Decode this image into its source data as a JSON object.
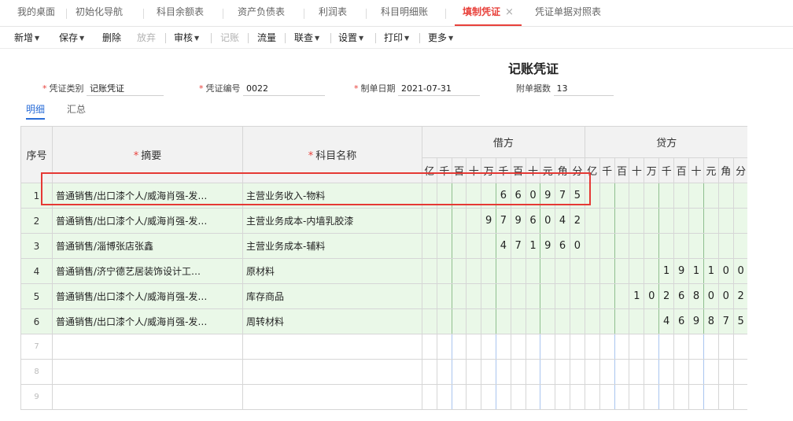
{
  "tabs": [
    {
      "label": "我的桌面"
    },
    {
      "label": "初始化导航"
    },
    {
      "label": "科目余额表"
    },
    {
      "label": "资产负债表"
    },
    {
      "label": "利润表"
    },
    {
      "label": "科目明细账"
    },
    {
      "label": "填制凭证",
      "close": "×"
    },
    {
      "label": "凭证单据对照表"
    }
  ],
  "toolbar": {
    "new": "新增",
    "save": "保存",
    "delete": "删除",
    "discard": "放弃",
    "audit": "审核",
    "post": "记账",
    "cashflow": "流量",
    "link": "联查",
    "settings": "设置",
    "print": "打印",
    "more": "更多"
  },
  "voucher": {
    "title": "记账凭证",
    "type_label": "凭证类别",
    "type_value": "记账凭证",
    "no_label": "凭证编号",
    "no_value": "0022",
    "date_label": "制单日期",
    "date_value": "2021-07-31",
    "attach_label": "附单据数",
    "attach_value": "13"
  },
  "subtabs": {
    "detail": "明细",
    "summary": "汇总"
  },
  "grid": {
    "col_seq": "序号",
    "col_summary": "摘要",
    "col_account": "科目名称",
    "col_debit": "借方",
    "col_credit": "贷方",
    "required_mark": "*",
    "digit_headers": [
      "亿",
      "千",
      "百",
      "十",
      "万",
      "千",
      "百",
      "十",
      "元",
      "角",
      "分"
    ],
    "rows": [
      {
        "seq": "1",
        "summary": "普通销售/出口漆个人/威海肖强-发…",
        "account": "主营业务收入-物料",
        "debit": [
          "",
          "",
          "",
          "",
          "",
          "6",
          "6",
          "0",
          "9",
          "7",
          "5"
        ],
        "credit": [
          "",
          "",
          "",
          "",
          "",
          "",
          "",
          "",
          "",
          "",
          ""
        ]
      },
      {
        "seq": "2",
        "summary": "普通销售/出口漆个人/威海肖强-发…",
        "account": "主营业务成本-内墙乳胶漆",
        "debit": [
          "",
          "",
          "",
          "",
          "9",
          "7",
          "9",
          "6",
          "0",
          "4",
          "2"
        ],
        "credit": [
          "",
          "",
          "",
          "",
          "",
          "",
          "",
          "",
          "",
          "",
          ""
        ]
      },
      {
        "seq": "3",
        "summary": "普通销售/淄博张店张鑫",
        "account": "主营业务成本-辅料",
        "debit": [
          "",
          "",
          "",
          "",
          "",
          "4",
          "7",
          "1",
          "9",
          "6",
          "0"
        ],
        "credit": [
          "",
          "",
          "",
          "",
          "",
          "",
          "",
          "",
          "",
          "",
          ""
        ]
      },
      {
        "seq": "4",
        "summary": "普通销售/济宁德艺居装饰设计工…",
        "account": "原材料",
        "debit": [
          "",
          "",
          "",
          "",
          "",
          "",
          "",
          "",
          "",
          "",
          ""
        ],
        "credit": [
          "",
          "",
          "",
          "",
          "",
          "1",
          "9",
          "1",
          "1",
          "0",
          "0"
        ]
      },
      {
        "seq": "5",
        "summary": "普通销售/出口漆个人/威海肖强-发…",
        "account": "库存商品",
        "debit": [
          "",
          "",
          "",
          "",
          "",
          "",
          "",
          "",
          "",
          "",
          ""
        ],
        "credit": [
          "",
          "",
          "",
          "1",
          "0",
          "2",
          "6",
          "8",
          "0",
          "0",
          "2"
        ]
      },
      {
        "seq": "6",
        "summary": "普通销售/出口漆个人/威海肖强-发…",
        "account": "周转材料",
        "debit": [
          "",
          "",
          "",
          "",
          "",
          "",
          "",
          "",
          "",
          "",
          ""
        ],
        "credit": [
          "",
          "",
          "",
          "",
          "",
          "4",
          "6",
          "9",
          "8",
          "7",
          "5"
        ]
      }
    ],
    "empty_rows": [
      "7",
      "8",
      "9"
    ]
  }
}
